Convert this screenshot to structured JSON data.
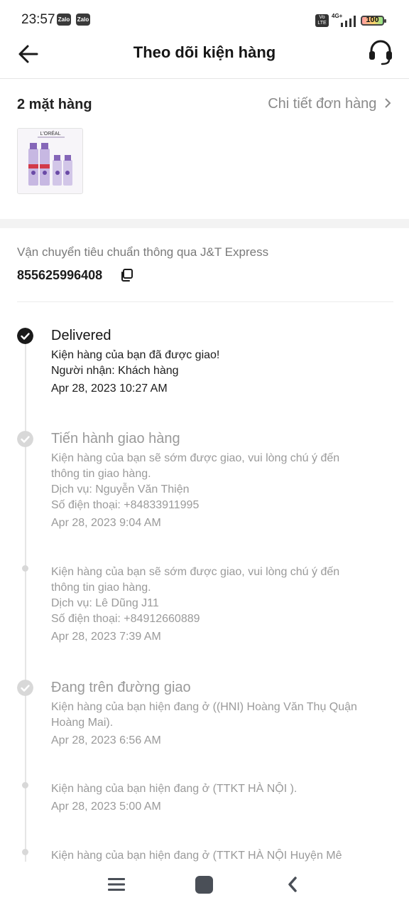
{
  "status_bar": {
    "time": "23:57",
    "notifications": [
      "Zalo",
      "Zalo"
    ],
    "volte": "Vo\nLTE",
    "network": "4G+",
    "battery": "100"
  },
  "header": {
    "title": "Theo dõi kiện hàng",
    "back_icon": "arrow-left-icon",
    "support_icon": "headset-icon"
  },
  "items": {
    "count_label": "2 mặt hàng",
    "detail_link": "Chi tiết đơn hàng",
    "thumbnail_brand": "L'ORÉAL"
  },
  "shipping": {
    "carrier": "Vận chuyển tiêu chuẩn thông qua J&T Express",
    "tracking_number": "855625996408",
    "copy_icon": "copy-icon"
  },
  "timeline": [
    {
      "title": "Delivered",
      "lines": [
        "Kiện hàng của bạn đã được giao!",
        "Người nhận: Khách hàng"
      ],
      "time": "Apr 28, 2023 10:27 AM"
    },
    {
      "title": "Tiến hành giao hàng",
      "lines": [
        "Kiện hàng của bạn sẽ sớm được giao, vui lòng chú ý đến",
        "thông tin giao hàng.",
        "Dịch vụ: Nguyễn Văn Thiện",
        "Số điện thoại: +84833911995"
      ],
      "time": "Apr 28, 2023 9:04 AM"
    },
    {
      "title": "",
      "lines": [
        "Kiện hàng của bạn sẽ sớm được giao, vui lòng chú ý đến",
        "thông tin giao hàng.",
        "Dịch vụ: Lê Dũng J11",
        "Số điện thoại: +84912660889"
      ],
      "time": "Apr 28, 2023 7:39 AM"
    },
    {
      "title": "Đang trên đường giao",
      "lines": [
        "Kiện hàng của bạn hiện đang ở ((HNI) Hoàng Văn Thụ Quận",
        "Hoàng Mai)."
      ],
      "time": "Apr 28, 2023 6:56 AM"
    },
    {
      "title": "",
      "lines": [
        "Kiện hàng của bạn hiện đang ở (TTKT HÀ NỘI )."
      ],
      "time": "Apr 28, 2023 5:00 AM"
    },
    {
      "title": "",
      "lines": [
        "Kiện hàng của bạn hiện đang ở (TTKT HÀ NỘI Huyện Mê"
      ],
      "time": ""
    }
  ],
  "nav": {
    "menu_icon": "menu-icon",
    "home_icon": "home-icon",
    "back_icon": "chevron-left-icon"
  }
}
